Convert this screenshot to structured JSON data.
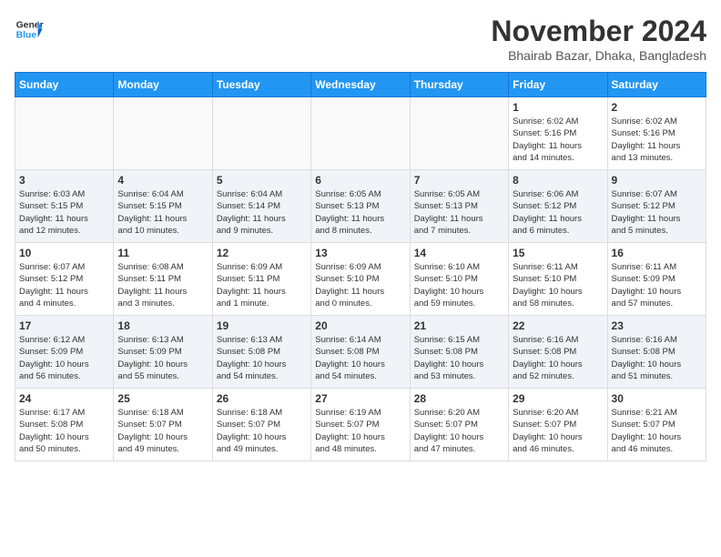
{
  "header": {
    "logo_line1": "General",
    "logo_line2": "Blue",
    "title": "November 2024",
    "subtitle": "Bhairab Bazar, Dhaka, Bangladesh"
  },
  "weekdays": [
    "Sunday",
    "Monday",
    "Tuesday",
    "Wednesday",
    "Thursday",
    "Friday",
    "Saturday"
  ],
  "weeks": [
    [
      {
        "date": "",
        "info": ""
      },
      {
        "date": "",
        "info": ""
      },
      {
        "date": "",
        "info": ""
      },
      {
        "date": "",
        "info": ""
      },
      {
        "date": "",
        "info": ""
      },
      {
        "date": "1",
        "info": "Sunrise: 6:02 AM\nSunset: 5:16 PM\nDaylight: 11 hours\nand 14 minutes."
      },
      {
        "date": "2",
        "info": "Sunrise: 6:02 AM\nSunset: 5:16 PM\nDaylight: 11 hours\nand 13 minutes."
      }
    ],
    [
      {
        "date": "3",
        "info": "Sunrise: 6:03 AM\nSunset: 5:15 PM\nDaylight: 11 hours\nand 12 minutes."
      },
      {
        "date": "4",
        "info": "Sunrise: 6:04 AM\nSunset: 5:15 PM\nDaylight: 11 hours\nand 10 minutes."
      },
      {
        "date": "5",
        "info": "Sunrise: 6:04 AM\nSunset: 5:14 PM\nDaylight: 11 hours\nand 9 minutes."
      },
      {
        "date": "6",
        "info": "Sunrise: 6:05 AM\nSunset: 5:13 PM\nDaylight: 11 hours\nand 8 minutes."
      },
      {
        "date": "7",
        "info": "Sunrise: 6:05 AM\nSunset: 5:13 PM\nDaylight: 11 hours\nand 7 minutes."
      },
      {
        "date": "8",
        "info": "Sunrise: 6:06 AM\nSunset: 5:12 PM\nDaylight: 11 hours\nand 6 minutes."
      },
      {
        "date": "9",
        "info": "Sunrise: 6:07 AM\nSunset: 5:12 PM\nDaylight: 11 hours\nand 5 minutes."
      }
    ],
    [
      {
        "date": "10",
        "info": "Sunrise: 6:07 AM\nSunset: 5:12 PM\nDaylight: 11 hours\nand 4 minutes."
      },
      {
        "date": "11",
        "info": "Sunrise: 6:08 AM\nSunset: 5:11 PM\nDaylight: 11 hours\nand 3 minutes."
      },
      {
        "date": "12",
        "info": "Sunrise: 6:09 AM\nSunset: 5:11 PM\nDaylight: 11 hours\nand 1 minute."
      },
      {
        "date": "13",
        "info": "Sunrise: 6:09 AM\nSunset: 5:10 PM\nDaylight: 11 hours\nand 0 minutes."
      },
      {
        "date": "14",
        "info": "Sunrise: 6:10 AM\nSunset: 5:10 PM\nDaylight: 10 hours\nand 59 minutes."
      },
      {
        "date": "15",
        "info": "Sunrise: 6:11 AM\nSunset: 5:10 PM\nDaylight: 10 hours\nand 58 minutes."
      },
      {
        "date": "16",
        "info": "Sunrise: 6:11 AM\nSunset: 5:09 PM\nDaylight: 10 hours\nand 57 minutes."
      }
    ],
    [
      {
        "date": "17",
        "info": "Sunrise: 6:12 AM\nSunset: 5:09 PM\nDaylight: 10 hours\nand 56 minutes."
      },
      {
        "date": "18",
        "info": "Sunrise: 6:13 AM\nSunset: 5:09 PM\nDaylight: 10 hours\nand 55 minutes."
      },
      {
        "date": "19",
        "info": "Sunrise: 6:13 AM\nSunset: 5:08 PM\nDaylight: 10 hours\nand 54 minutes."
      },
      {
        "date": "20",
        "info": "Sunrise: 6:14 AM\nSunset: 5:08 PM\nDaylight: 10 hours\nand 54 minutes."
      },
      {
        "date": "21",
        "info": "Sunrise: 6:15 AM\nSunset: 5:08 PM\nDaylight: 10 hours\nand 53 minutes."
      },
      {
        "date": "22",
        "info": "Sunrise: 6:16 AM\nSunset: 5:08 PM\nDaylight: 10 hours\nand 52 minutes."
      },
      {
        "date": "23",
        "info": "Sunrise: 6:16 AM\nSunset: 5:08 PM\nDaylight: 10 hours\nand 51 minutes."
      }
    ],
    [
      {
        "date": "24",
        "info": "Sunrise: 6:17 AM\nSunset: 5:08 PM\nDaylight: 10 hours\nand 50 minutes."
      },
      {
        "date": "25",
        "info": "Sunrise: 6:18 AM\nSunset: 5:07 PM\nDaylight: 10 hours\nand 49 minutes."
      },
      {
        "date": "26",
        "info": "Sunrise: 6:18 AM\nSunset: 5:07 PM\nDaylight: 10 hours\nand 49 minutes."
      },
      {
        "date": "27",
        "info": "Sunrise: 6:19 AM\nSunset: 5:07 PM\nDaylight: 10 hours\nand 48 minutes."
      },
      {
        "date": "28",
        "info": "Sunrise: 6:20 AM\nSunset: 5:07 PM\nDaylight: 10 hours\nand 47 minutes."
      },
      {
        "date": "29",
        "info": "Sunrise: 6:20 AM\nSunset: 5:07 PM\nDaylight: 10 hours\nand 46 minutes."
      },
      {
        "date": "30",
        "info": "Sunrise: 6:21 AM\nSunset: 5:07 PM\nDaylight: 10 hours\nand 46 minutes."
      }
    ]
  ]
}
